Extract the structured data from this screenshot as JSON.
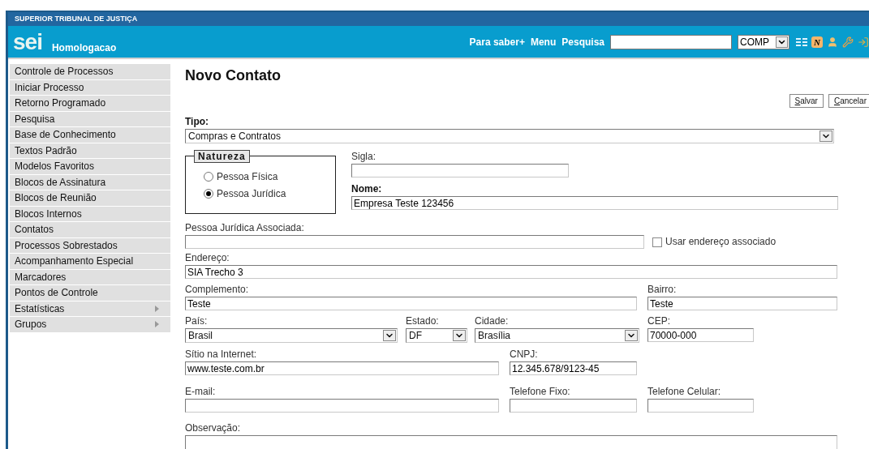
{
  "header": {
    "organization": "SUPERIOR TRIBUNAL DE JUSTIÇA",
    "logo": "sei",
    "environment": "Homologacao",
    "links": [
      "Para saber+",
      "Menu",
      "Pesquisa"
    ],
    "unit_select": {
      "value": "COMP"
    },
    "badge": "N"
  },
  "sidebar": {
    "items": [
      {
        "label": "Controle de Processos",
        "submenu": false
      },
      {
        "label": "Iniciar Processo",
        "submenu": false
      },
      {
        "label": "Retorno Programado",
        "submenu": false
      },
      {
        "label": "Pesquisa",
        "submenu": false
      },
      {
        "label": "Base de Conhecimento",
        "submenu": false
      },
      {
        "label": "Textos Padrão",
        "submenu": false
      },
      {
        "label": "Modelos Favoritos",
        "submenu": false
      },
      {
        "label": "Blocos de Assinatura",
        "submenu": false
      },
      {
        "label": "Blocos de Reunião",
        "submenu": false
      },
      {
        "label": "Blocos Internos",
        "submenu": false
      },
      {
        "label": "Contatos",
        "submenu": false
      },
      {
        "label": "Processos Sobrestados",
        "submenu": false
      },
      {
        "label": "Acompanhamento Especial",
        "submenu": false
      },
      {
        "label": "Marcadores",
        "submenu": false
      },
      {
        "label": "Pontos de Controle",
        "submenu": false
      },
      {
        "label": "Estatísticas",
        "submenu": true
      },
      {
        "label": "Grupos",
        "submenu": true
      }
    ]
  },
  "page": {
    "title": "Novo Contato",
    "buttons": [
      "Salvar",
      "Cancelar"
    ]
  },
  "form": {
    "tipo": {
      "label": "Tipo:",
      "value": "Compras e Contratos",
      "required": true
    },
    "natureza": {
      "legend": "Natureza",
      "options": [
        {
          "label": "Pessoa Física",
          "selected": false
        },
        {
          "label": "Pessoa Jurídica",
          "selected": true
        }
      ]
    },
    "sigla": {
      "label": "Sigla:",
      "required": false
    },
    "nome": {
      "label": "Nome:",
      "value": "Empresa Teste 123456",
      "required": true
    },
    "pessoa_juridica_associada": {
      "label": "Pessoa Jurídica Associada:",
      "required": false
    },
    "usar_endereco": {
      "label": "Usar endereço associado",
      "checked": false
    },
    "endereco": {
      "label": "Endereço:",
      "value": "SIA Trecho 3",
      "required": false
    },
    "complemento": {
      "label": "Complemento:",
      "value": "Teste",
      "required": false
    },
    "bairro": {
      "label": "Bairro:",
      "value": "Teste",
      "required": false
    },
    "pais": {
      "label": "País:",
      "value": "Brasil",
      "required": false
    },
    "estado": {
      "label": "Estado:",
      "value": "DF",
      "required": false
    },
    "cidade": {
      "label": "Cidade:",
      "value": "Brasília",
      "required": false
    },
    "cep": {
      "label": "CEP:",
      "value": "70000-000",
      "required": false
    },
    "sitio": {
      "label": "Sítio na Internet:",
      "value": "www.teste.com.br",
      "required": false
    },
    "cnpj": {
      "label": "CNPJ:",
      "value": "12.345.678/9123-45",
      "required": false
    },
    "email": {
      "label": "E-mail:",
      "required": false
    },
    "telefone_fixo": {
      "label": "Telefone Fixo:",
      "required": false
    },
    "telefone_celular": {
      "label": "Telefone Celular:",
      "required": false
    },
    "observacao": {
      "label": "Observação:",
      "required": false
    }
  }
}
